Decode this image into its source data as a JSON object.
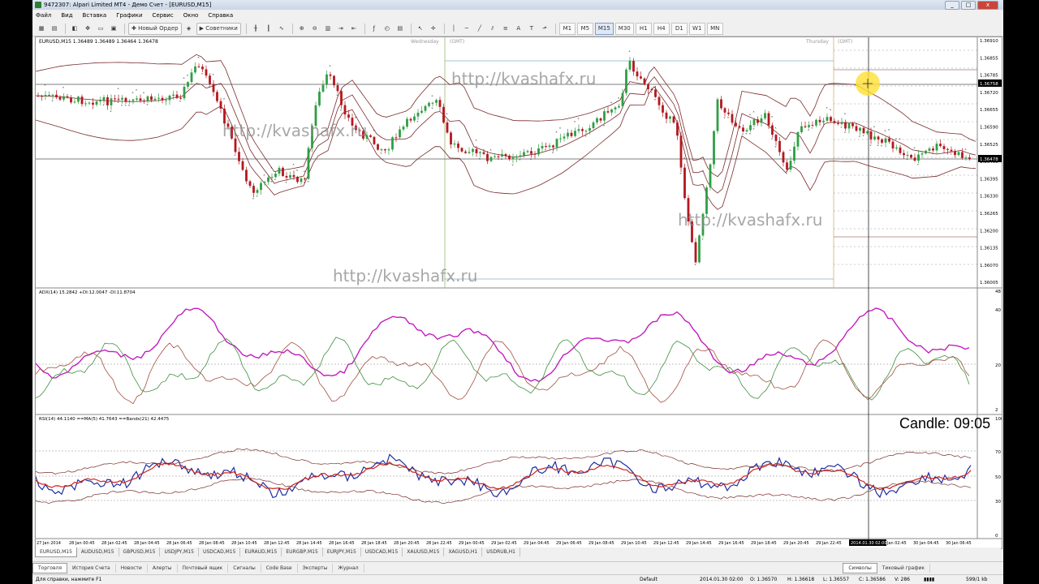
{
  "window": {
    "title": "9472307: Alpari Limited MT4 - Демо Счет - [EURUSD,M15]",
    "buttons": [
      "_",
      "□",
      "x"
    ]
  },
  "menu": [
    "Файл",
    "Вид",
    "Вставка",
    "Графики",
    "Сервис",
    "Окно",
    "Справка"
  ],
  "toolbar": {
    "new_order": "Новый Ордер",
    "experts": "Советники",
    "timeframes": [
      "M1",
      "M5",
      "M15",
      "M30",
      "H1",
      "H4",
      "D1",
      "W1",
      "MN"
    ],
    "active_timeframe": "M15"
  },
  "chart": {
    "main_header": "EURUSD,M15  1.36489 1.36489 1.36464 1.36478",
    "day_labels": [
      "Wednesday",
      "(GMT)",
      "Thursday",
      "(GMT)"
    ],
    "watermark": "http://kvashafx.ru",
    "price_labels": [
      "1.36910",
      "1.36855",
      "1.36785",
      "1.36720",
      "1.36655",
      "1.36590",
      "1.36525",
      "1.36460",
      "1.36395",
      "1.36330",
      "1.36265",
      "1.36200",
      "1.36135",
      "1.36070",
      "1.36005"
    ],
    "current_price": "1.36478",
    "highlight_price": "1.36758",
    "adx_header": "ADX(14) 15.2842 +DI:12.0047 -DI:11.8704",
    "adx_levels": [
      "48",
      "40",
      "20",
      "2"
    ],
    "rsi_header": "RSI(14) 44.1140  ==MA(5) 41.7643  ==Bands(21) 42.4475",
    "rsi_levels": [
      "100",
      "70",
      "50",
      "30",
      "0"
    ],
    "candle_timer": "Candle:  09:05",
    "time_labels": [
      "27 Jan 2014",
      "28 Jan 00:45",
      "28 Jan 02:45",
      "28 Jan 04:45",
      "28 Jan 06:45",
      "28 Jan 08:45",
      "28 Jan 10:45",
      "28 Jan 12:45",
      "28 Jan 14:45",
      "28 Jan 16:45",
      "28 Jan 18:45",
      "28 Jan 20:45",
      "28 Jan 22:45",
      "29 Jan 00:45",
      "29 Jan 02:45",
      "29 Jan 04:45",
      "29 Jan 06:45",
      "29 Jan 08:45",
      "29 Jan 10:45",
      "29 Jan 12:45",
      "29 Jan 14:45",
      "29 Jan 16:45",
      "29 Jan 18:45",
      "29 Jan 20:45",
      "29 Jan 22:45",
      "2014.01.30 02:00",
      "30 Jan 02:45",
      "30 Jan 04:45",
      "30 Jan 06:45"
    ],
    "crosshair_time": "2014.01.30 02:00"
  },
  "symbol_tabs": [
    "EURUSD,M15",
    "AUDUSD,M15",
    "GBPUSD,M15",
    "USDJPY,M15",
    "USDCAD,M15",
    "EURAUD,M15",
    "EURGBP,M15",
    "EURJPY,M15",
    "USDCAD,M15",
    "XAUUSD,M15",
    "XAGUSD,H1",
    "USDRUB,H1"
  ],
  "terminal_tabs": [
    "Торговля",
    "История Счета",
    "Новости",
    "Алерты",
    "Почтовый ящик",
    "Сигналы",
    "Code Base",
    "Эксперты",
    "Журнал"
  ],
  "right_tabs": [
    "Символы",
    "Тиковый график"
  ],
  "status": {
    "help": "Для справки, нажмите F1",
    "profile": "Default",
    "datetime": "2014.01.30 02:00",
    "open": "O: 1.36570",
    "high": "H: 1.36618",
    "low": "L: 1.36557",
    "close": "C: 1.36586",
    "volume": "V: 286",
    "traffic": "599/1 kb"
  },
  "colors": {
    "bull": "#2f9e44",
    "bear": "#b3181f",
    "bands": "#7a2b2b",
    "adx": "#c21fbd",
    "plus_di": "#3f8f3f",
    "minus_di": "#a05040",
    "rsi": "#1f2ea0",
    "rsi_ma": "#d0241b"
  }
}
